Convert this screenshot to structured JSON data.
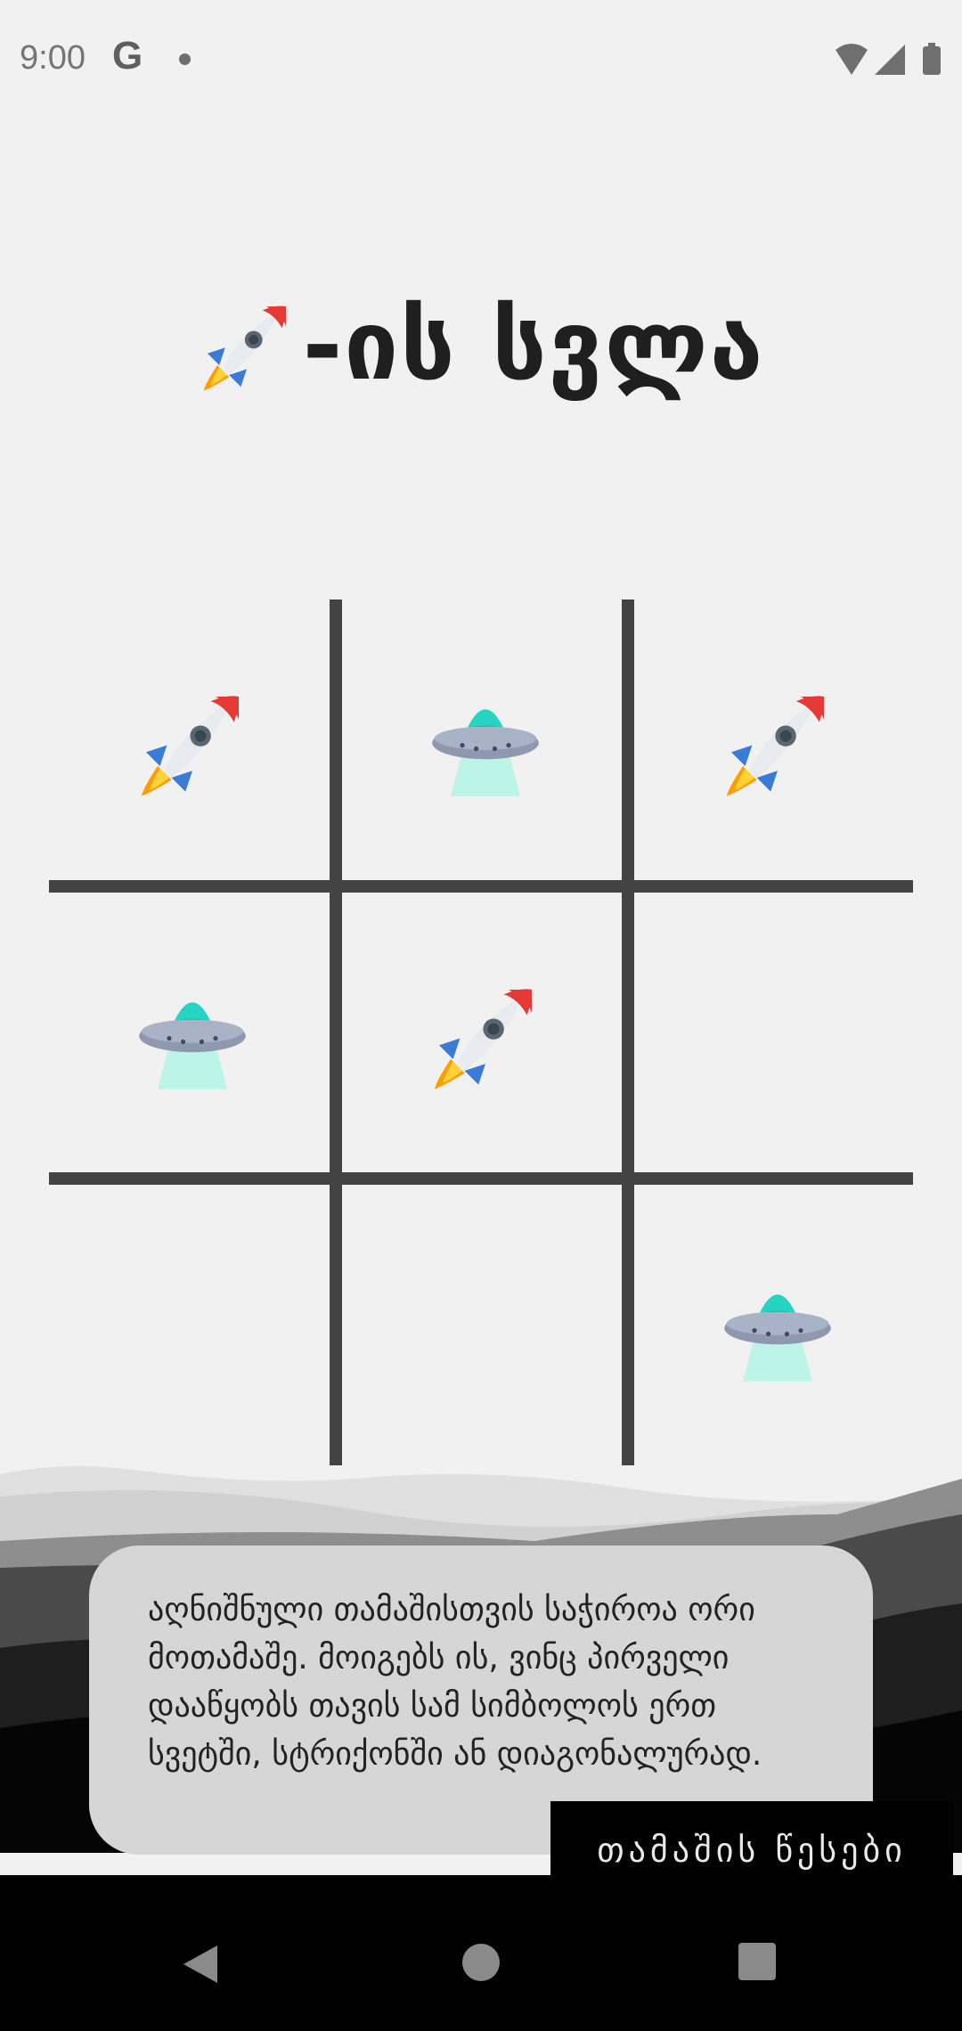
{
  "status_bar": {
    "time": "9:00",
    "g_label": "G"
  },
  "header": {
    "title_suffix": "-ის სვლა",
    "current_player": "rocket-icon"
  },
  "board": {
    "cells": [
      "rocket",
      "ufo",
      "rocket",
      "ufo",
      "rocket",
      "",
      "",
      "",
      "ufo"
    ]
  },
  "rules": {
    "text": "აღნიშნული თამაშისთვის საჭიროა ორი მოთამაშე. მოიგებს ის, ვინც პირველი დააწყობს თავის სამ სიმბოლოს ერთ სვეტში, სტრიქონში ან დიაგონალურად.",
    "button_label": "თამაშის წესები"
  },
  "colors": {
    "grid": "#434343",
    "background": "#f1f1f1",
    "popup": "#d6d6d6"
  }
}
